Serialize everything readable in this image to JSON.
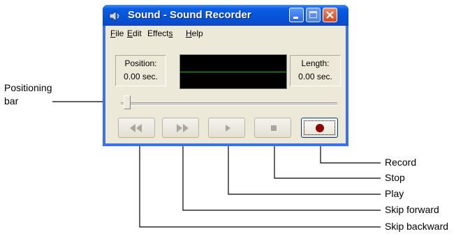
{
  "window": {
    "title": "Sound - Sound Recorder",
    "accent": "#0653d8"
  },
  "menu": {
    "items": [
      {
        "label": "File",
        "mnemonic": "F"
      },
      {
        "label": "Edit",
        "mnemonic": "E"
      },
      {
        "label": "Effects",
        "mnemonic": "s"
      },
      {
        "label": "Help",
        "mnemonic": "H"
      }
    ]
  },
  "position": {
    "label": "Position:",
    "value": "0.00 sec."
  },
  "length": {
    "label": "Length:",
    "value": "0.00 sec."
  },
  "slider": {
    "value": 0
  },
  "controls": [
    {
      "name": "skip-backward",
      "icon": "rewind-icon",
      "enabled": false
    },
    {
      "name": "skip-forward",
      "icon": "fast-forward-icon",
      "enabled": false
    },
    {
      "name": "play",
      "icon": "play-icon",
      "enabled": false
    },
    {
      "name": "stop",
      "icon": "stop-icon",
      "enabled": false
    },
    {
      "name": "record",
      "icon": "record-icon",
      "enabled": true,
      "color": "#8b0000"
    }
  ],
  "callouts": {
    "positioning_bar": [
      "Positioning",
      "bar"
    ],
    "record": "Record",
    "stop": "Stop",
    "play": "Play",
    "skip_forward": "Skip forward",
    "skip_backward": "Skip backward"
  }
}
